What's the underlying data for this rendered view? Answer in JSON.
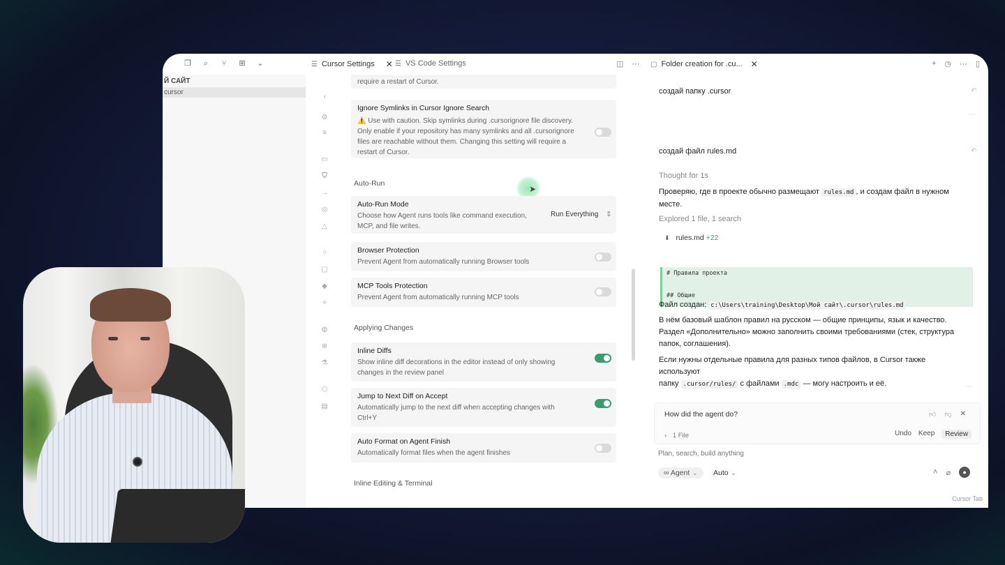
{
  "explorer": {
    "header": "Й САЙТ",
    "selected_item": "cursor"
  },
  "tabs": [
    {
      "label": "Cursor Settings"
    },
    {
      "label": "VS Code Settings"
    },
    {
      "label": "Folder creation for .cu..."
    }
  ],
  "settings": {
    "truncated_top_desc": "require a restart of Cursor.",
    "ignore_symlinks": {
      "title": "Ignore Symlinks in Cursor Ignore Search",
      "desc1": "⚠️ Use with caution. Skip symlinks during .cursorignore file discovery.",
      "desc2": "Only enable if your repository has many symlinks and all .cursorignore",
      "desc3": "files are reachable without them. Changing this setting will require a",
      "desc4": "restart of Cursor."
    },
    "auto_run_header": "Auto-Run",
    "auto_run_mode": {
      "title": "Auto-Run Mode",
      "desc1": "Choose how Agent runs tools like command execution,",
      "desc2": "MCP, and file writes.",
      "value": "Run Everything"
    },
    "browser_protection": {
      "title": "Browser Protection",
      "desc": "Prevent Agent from automatically running Browser tools"
    },
    "mcp_protection": {
      "title": "MCP Tools Protection",
      "desc": "Prevent Agent from automatically running MCP tools"
    },
    "applying_changes_header": "Applying Changes",
    "inline_diffs": {
      "title": "Inline Diffs",
      "desc1": "Show inline diff decorations in the editor instead of only showing",
      "desc2": "changes in the review panel"
    },
    "jump_next_diff": {
      "title": "Jump to Next Diff on Accept",
      "desc1": "Automatically jump to the next diff when accepting changes with",
      "desc2": "Ctrl+Y"
    },
    "auto_format": {
      "title": "Auto Format on Agent Finish",
      "desc": "Automatically format files when the agent finishes"
    },
    "inline_editing_header": "Inline Editing & Terminal"
  },
  "chat": {
    "user_msg_1": "создай папку .cursor",
    "user_msg_2": "создай файл rules.md",
    "thought": "Thought for 1s",
    "reply_1a": "Проверяю, где в проекте обычно размещают",
    "reply_1_code": "rules.md",
    "reply_1b": ", и создам файл в нужном",
    "reply_1c": "месте.",
    "explored": "Explored 1 file, 1 search",
    "file_name": "rules.md",
    "file_diff": "+22",
    "file_line_1": "# Правила проекта",
    "file_line_2": "## Общие",
    "created_label": "Файл создан:",
    "created_path": "c:\\Users\\training\\Desktop\\Мой сайт\\.cursor\\rules.md",
    "para_2a": "В нём базовый шаблон правил на русском — общие принципы, язык и качество.",
    "para_2b": "Раздел «Дополнительно» можно заполнить своими требованиями (стек, структура",
    "para_2c": "папок, соглашения).",
    "para_3a": "Если нужны отдельные правила для разных типов файлов, в Cursor также используют",
    "para_3b_pre": "папку",
    "para_3b_code": ".cursor/rules/",
    "para_3b_mid": "с файлами",
    "para_3b_code2": ".mdc",
    "para_3b_post": "— могу настроить и её.",
    "feedback": "How did the agent do?",
    "files_count": "1 File",
    "undo": "Undo",
    "keep": "Keep",
    "review": "Review",
    "input_placeholder": "Plan, search, build anything",
    "agent_mode": "Agent",
    "model": "Auto"
  },
  "status_bar": {
    "right": "Cursor Tab"
  },
  "colors": {
    "toggle_on": "#3d9c6f",
    "toggle_off": "#dadada"
  }
}
